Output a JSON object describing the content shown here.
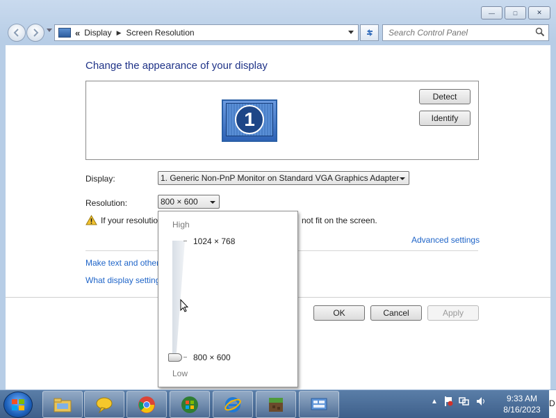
{
  "window": {
    "controls": {
      "minimize": "—",
      "maximize": "□",
      "close": "✕"
    }
  },
  "address_bar": {
    "chevron": "«",
    "crumbs": [
      "Display",
      "Screen Resolution"
    ],
    "separator": "▶"
  },
  "search": {
    "placeholder": "Search Control Panel"
  },
  "page": {
    "title": "Change the appearance of your display",
    "monitor_number": "1",
    "detect_label": "Detect",
    "identify_label": "Identify",
    "display_label": "Display:",
    "display_value": "1. Generic Non-PnP Monitor on Standard VGA Graphics Adapter",
    "resolution_label": "Resolution:",
    "resolution_value": "800 × 600",
    "warning_text_left": "If your resolutio",
    "warning_text_right": "not fit on the screen.",
    "advanced_link": "Advanced settings",
    "link1": "Make text and other",
    "link2": "What display setting",
    "ok_label": "OK",
    "cancel_label": "Cancel",
    "apply_label": "Apply"
  },
  "resolution_dropdown": {
    "high_label": "High",
    "low_label": "Low",
    "top_option": "1024 × 768",
    "bottom_option": "800 × 600",
    "slider_level": 0
  },
  "taskbar": {
    "items": [
      "file-explorer",
      "speech-bubble-app",
      "chrome",
      "windows-media",
      "internet-explorer",
      "minecraft",
      "control-panel"
    ],
    "clock_time": "9:33 AM",
    "clock_date": "8/16/2023",
    "edge_text": "D"
  },
  "colors": {
    "title": "#1e3287",
    "link": "#1e64c8",
    "taskbar": "#4a6c98"
  }
}
